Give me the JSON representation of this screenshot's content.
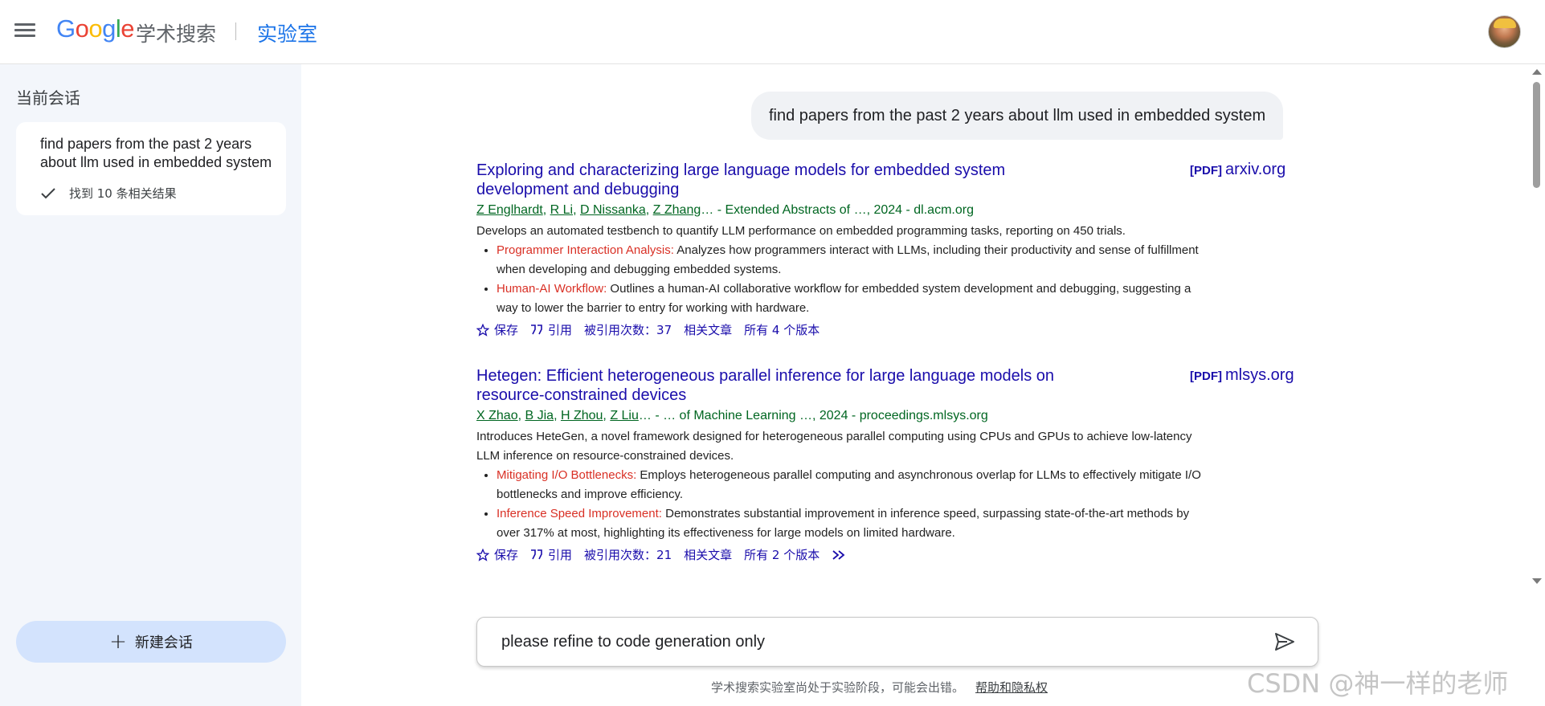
{
  "header": {
    "logo_letters": [
      "G",
      "o",
      "o",
      "g",
      "l",
      "e"
    ],
    "product": "学术搜索",
    "lab": "实验室"
  },
  "sidebar": {
    "title": "当前会话",
    "session": {
      "title": "find papers from the past 2 years about llm used in embedded system",
      "status": "找到 10 条相关结果"
    },
    "new_chat_label": "新建会话"
  },
  "chat": {
    "user_query": "find papers from the past 2 years about llm used in embedded system",
    "results": [
      {
        "title": "Exploring and characterizing large language models for embedded system development and debugging",
        "pdf_tag": "[PDF]",
        "source": "arxiv.org",
        "authors": [
          "Z Englhardt",
          "R Li",
          "D Nissanka",
          "Z Zhang"
        ],
        "venue": "… - Extended Abstracts of …, 2024 - dl.acm.org",
        "summary": "Develops an automated testbench to quantify LLM performance on embedded programming tasks, reporting on 450 trials.",
        "bullets": [
          {
            "label": "Programmer Interaction Analysis:",
            "text": " Analyzes how programmers interact with LLMs, including their productivity and sense of fulfillment when developing and debugging embedded systems."
          },
          {
            "label": "Human-AI Workflow:",
            "text": " Outlines a human-AI collaborative workflow for embedded system development and debugging, suggesting a way to lower the barrier to entry for working with hardware."
          }
        ],
        "actions": {
          "save": "保存",
          "cite": "引用",
          "cited_by": "被引用次数：37",
          "related": "相关文章",
          "versions": "所有 4 个版本"
        }
      },
      {
        "title": "Hetegen: Efficient heterogeneous parallel inference for large language models on resource-constrained devices",
        "pdf_tag": "[PDF]",
        "source": "mlsys.org",
        "authors": [
          "X Zhao",
          "B Jia",
          "H Zhou",
          "Z Liu"
        ],
        "venue": "… - … of Machine Learning …, 2024 - proceedings.mlsys.org",
        "summary": "Introduces HeteGen, a novel framework designed for heterogeneous parallel computing using CPUs and GPUs to achieve low-latency LLM inference on resource-constrained devices.",
        "bullets": [
          {
            "label": "Mitigating I/O Bottlenecks:",
            "text": " Employs heterogeneous parallel computing and asynchronous overlap for LLMs to effectively mitigate I/O bottlenecks and improve efficiency."
          },
          {
            "label": "Inference Speed Improvement:",
            "text": " Demonstrates substantial improvement in inference speed, surpassing state-of-the-art methods by over 317% at most, highlighting its effectiveness for large models on limited hardware."
          }
        ],
        "actions": {
          "save": "保存",
          "cite": "引用",
          "cited_by": "被引用次数：21",
          "related": "相关文章",
          "versions": "所有 2 个版本"
        }
      }
    ]
  },
  "composer": {
    "value": "please refine to code generation only"
  },
  "footer": {
    "notice": "学术搜索实验室尚处于实验阶段，可能会出错。",
    "help_link": "帮助和隐私权"
  },
  "watermark": "CSDN @神一样的老师",
  "colors": {
    "link": "#1a0dab",
    "meta_green": "#006621",
    "highlight_red": "#d93025",
    "sidebar_bg": "#f3f6fb",
    "new_chat_bg": "#d3e3fd"
  }
}
